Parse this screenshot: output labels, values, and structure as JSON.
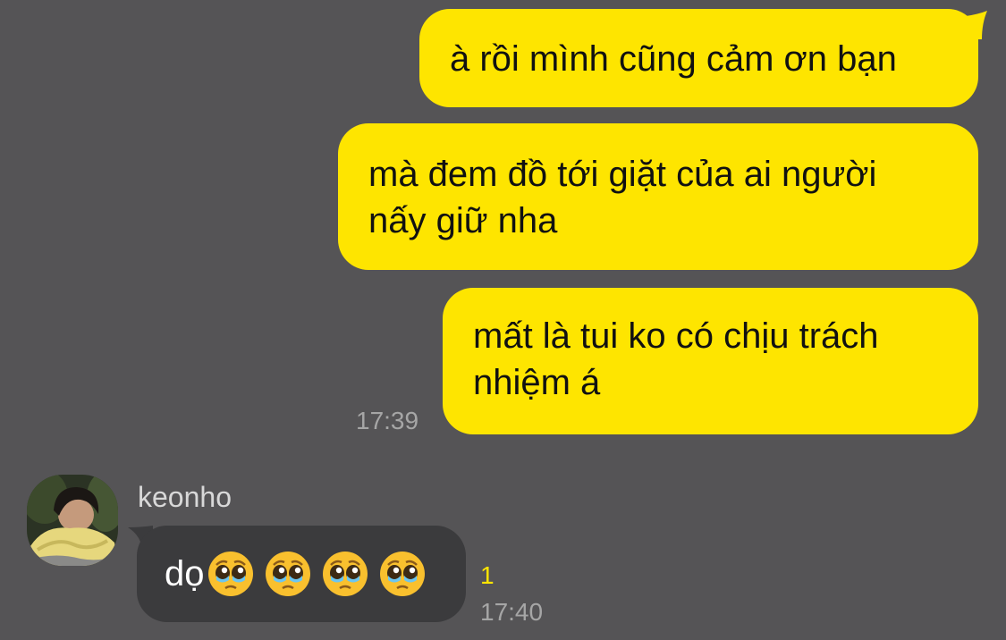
{
  "colors": {
    "background": "#555456",
    "outgoing_bubble": "#fee500",
    "incoming_bubble": "#3b3b3d",
    "timestamp": "#a6a6a6",
    "unread_count": "#fee500"
  },
  "messages_out": [
    {
      "text": "à rồi mình cũng cảm ơn bạn"
    },
    {
      "line1": "mà đem đồ tới giặt của ai người",
      "line2": "nấy giữ nha"
    },
    {
      "line1": "mất là tui ko có chịu trách",
      "line2": "nhiệm á",
      "time": "17:39"
    }
  ],
  "message_in": {
    "sender": "keonho",
    "avatar_icon": "profile-photo",
    "text": "dọ",
    "emoji_icon": "pleading-face-emoji",
    "emoji_count": 4,
    "unread": "1",
    "time": "17:40"
  }
}
